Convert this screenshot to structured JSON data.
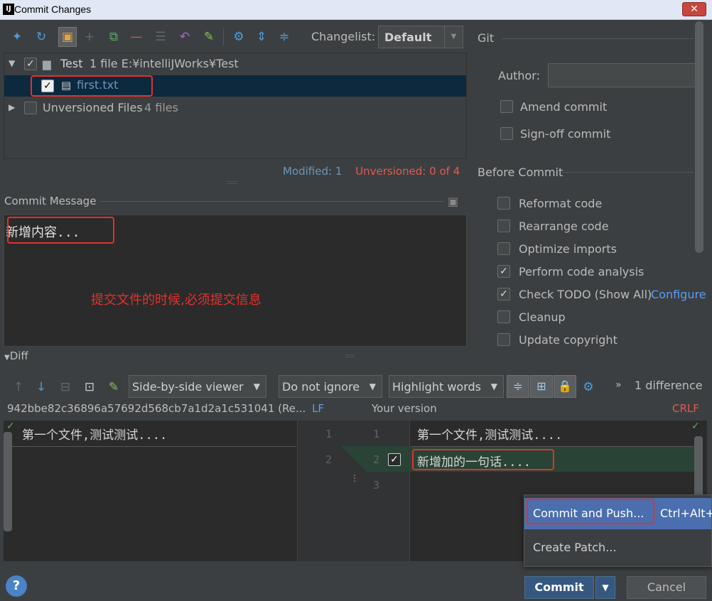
{
  "window": {
    "title": "Commit Changes",
    "close": "✕"
  },
  "toolbar": {
    "changelist_label": "Changelist:",
    "changelist_value": "Default",
    "git_label": "Git"
  },
  "tree": {
    "root_name": "Test",
    "root_meta": "1 file  E:¥intelliJWorks¥Test",
    "file_name": "first.txt",
    "unversioned_name": "Unversioned Files",
    "unversioned_meta": "4 files"
  },
  "status": {
    "modified": "Modified: 1",
    "unversioned": "Unversioned: 0 of 4"
  },
  "commit_message": {
    "label": "Commit Message",
    "text": "新增内容...",
    "annotation": "提交文件的时候,必须提交信息"
  },
  "git_panel": {
    "author_label": "Author:",
    "amend": "Amend commit",
    "signoff": "Sign-off commit",
    "before_commit": "Before Commit",
    "options": [
      {
        "label": "Reformat code",
        "checked": false
      },
      {
        "label": "Rearrange code",
        "checked": false
      },
      {
        "label": "Optimize imports",
        "checked": false
      },
      {
        "label": "Perform code analysis",
        "checked": true
      },
      {
        "label": "Check TODO (Show All)",
        "checked": true
      },
      {
        "label": "Cleanup",
        "checked": false
      },
      {
        "label": "Update copyright",
        "checked": false
      }
    ],
    "configure_link": "Configure"
  },
  "diff": {
    "label": "Diff",
    "viewer": "Side-by-side viewer",
    "ignore": "Do not ignore",
    "highlight": "Highlight words",
    "differences": "1 difference",
    "left_header": "942bbe82c36896a57692d568cb7a1d2a1c531041 (Re...",
    "left_eol": "LF",
    "right_header": "Your version",
    "right_eol": "CRLF",
    "left_line1": "第一个文件,测试测试....",
    "right_line1": "第一个文件,测试测试....",
    "right_line2": "新增加的一句话....",
    "ln_left1": "1",
    "ln_left2": "2",
    "ln_right1": "1",
    "ln_right2": "2",
    "ln_right3": "3"
  },
  "popup": {
    "item1": "Commit and Push...",
    "item1_shortcut": "Ctrl+Alt+",
    "item2": "Create Patch..."
  },
  "buttons": {
    "help": "?",
    "commit": "Commit",
    "commit_drop": "▼",
    "cancel": "Cancel"
  }
}
